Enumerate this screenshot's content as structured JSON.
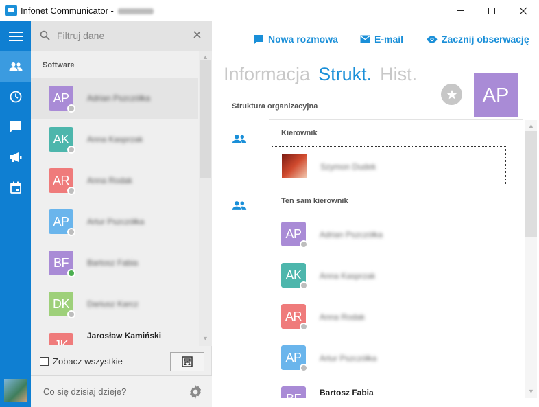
{
  "window": {
    "title": "Infonet Communicator - "
  },
  "search": {
    "placeholder": "Filtruj dane"
  },
  "contacts": {
    "group": "Software",
    "items": [
      {
        "initials": "AP",
        "name": "Adrian Pszczółka",
        "color": "#a98bd6",
        "status": "offline"
      },
      {
        "initials": "AK",
        "name": "Anna Kasprzak",
        "color": "#4db6ac",
        "status": "offline"
      },
      {
        "initials": "AR",
        "name": "Anna Rodak",
        "color": "#ef7b7b",
        "status": "offline"
      },
      {
        "initials": "AP",
        "name": "Artur Pszczółka",
        "color": "#6ab5ec",
        "status": "offline"
      },
      {
        "initials": "BF",
        "name": "Bartosz Fabia",
        "color": "#a98bd6",
        "status": "online"
      },
      {
        "initials": "DK",
        "name": "Dariusz Karcz",
        "color": "#9ed07a",
        "status": "offline"
      },
      {
        "initials": "JK",
        "name": "Jarosław Kamiński",
        "color": "#ef7b7b",
        "status": "offline"
      }
    ],
    "see_all_label": "Zobacz wszystkie"
  },
  "statusbar": {
    "placeholder": "Co się dzisiaj dzieje?"
  },
  "actions": {
    "new_chat": "Nowa rozmowa",
    "email": "E-mail",
    "observe": "Zacznij obserwację"
  },
  "tabs": {
    "info": "Informacja",
    "struct": "Strukt.",
    "hist": "Hist."
  },
  "profile": {
    "initials": "AP",
    "color": "#a98bd6"
  },
  "structure": {
    "title": "Struktura organizacyjna",
    "manager_label": "Kierownik",
    "manager_name": "Szymon Dudek",
    "peers_label": "Ten sam kierownik",
    "peers": [
      {
        "initials": "AP",
        "name": "Adrian Pszczółka",
        "color": "#a98bd6"
      },
      {
        "initials": "AK",
        "name": "Anna Kasprzak",
        "color": "#4db6ac"
      },
      {
        "initials": "AR",
        "name": "Anna Rodak",
        "color": "#ef7b7b"
      },
      {
        "initials": "AP",
        "name": "Artur Pszczółka",
        "color": "#6ab5ec"
      },
      {
        "initials": "BF",
        "name": "Bartosz Fabia",
        "color": "#a98bd6"
      }
    ]
  }
}
